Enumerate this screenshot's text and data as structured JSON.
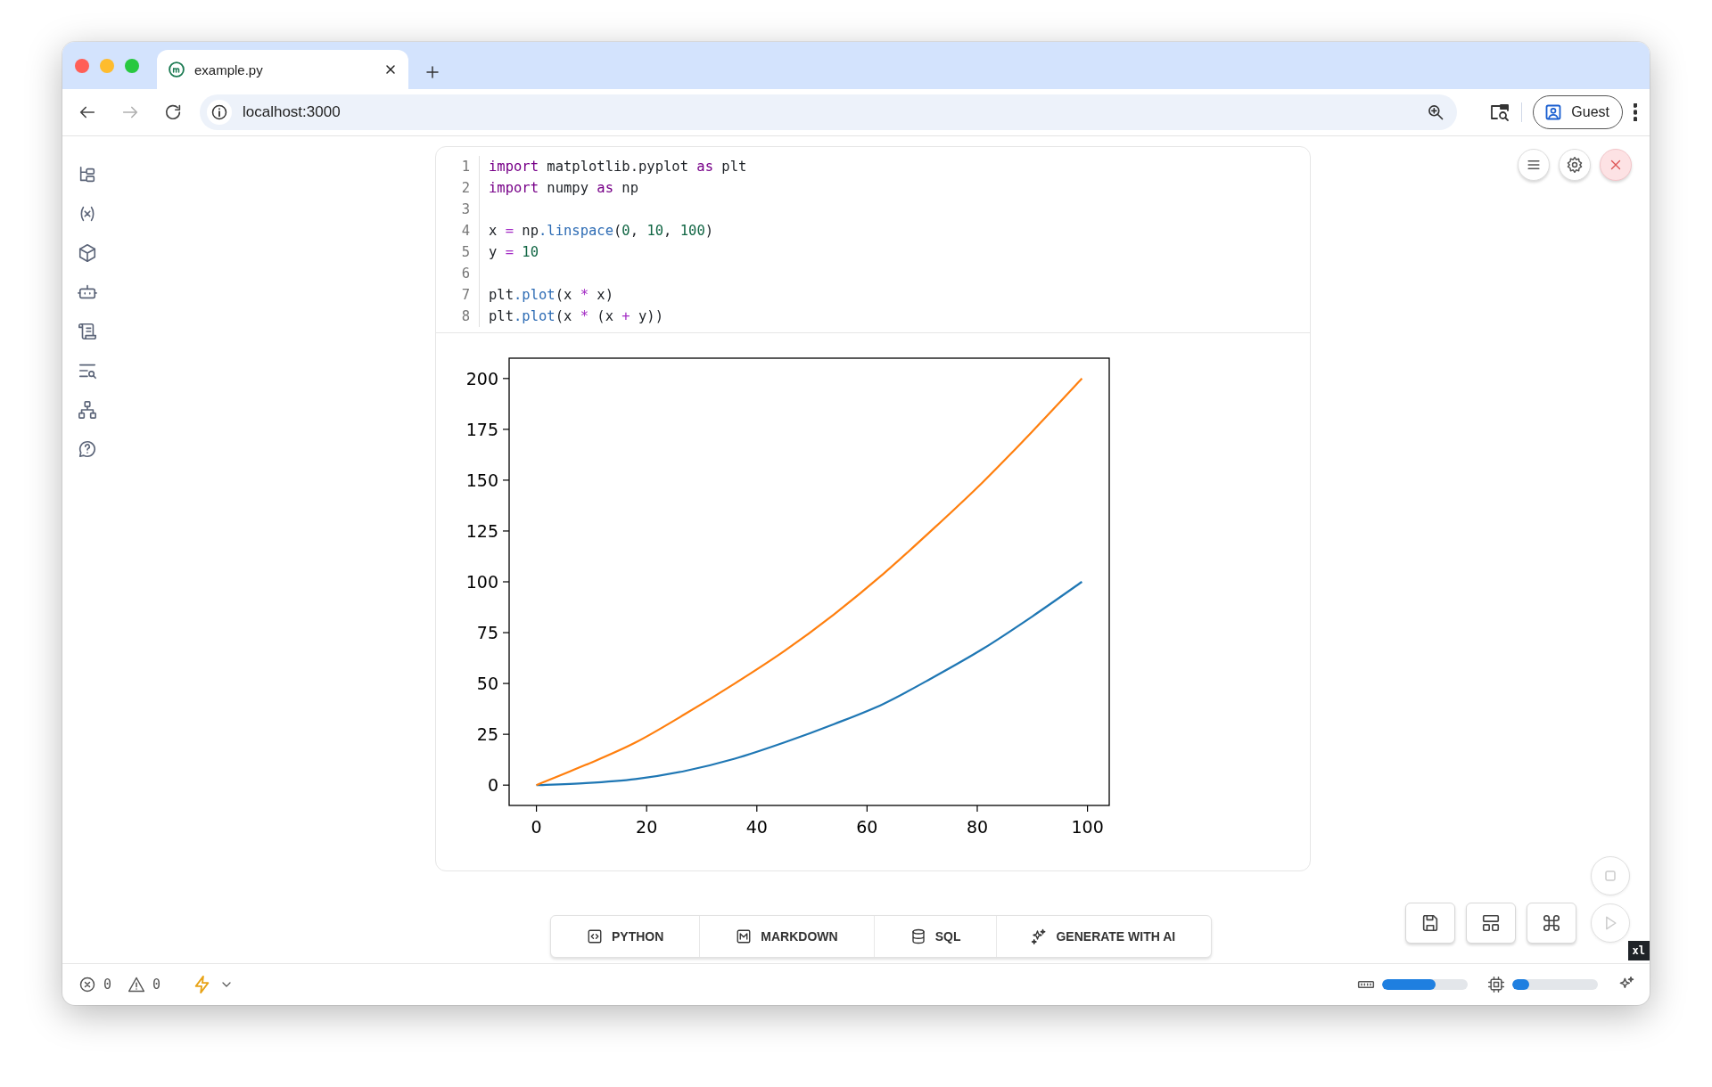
{
  "browser": {
    "tab": {
      "title": "example.py",
      "selected": true
    },
    "nav": [
      {
        "kind": "back",
        "disabled": false
      },
      {
        "kind": "forward",
        "disabled": true
      },
      {
        "kind": "reload",
        "disabled": false
      }
    ],
    "address": "localhost:3000",
    "profile": "Guest"
  },
  "sidebar": {
    "items": [
      {
        "kind": "tree"
      },
      {
        "kind": "variables"
      },
      {
        "kind": "package"
      },
      {
        "kind": "bot"
      },
      {
        "kind": "scroll"
      },
      {
        "kind": "search-list"
      },
      {
        "kind": "hierarchy"
      },
      {
        "kind": "help"
      }
    ]
  },
  "cell": {
    "lines": [
      {
        "number": "1",
        "tokens": [
          {
            "text": "import",
            "kind": "keyword"
          },
          {
            "text": " matplotlib.pyplot ",
            "kind": "plain"
          },
          {
            "text": "as",
            "kind": "keyword"
          },
          {
            "text": " plt",
            "kind": "plain"
          }
        ]
      },
      {
        "number": "2",
        "tokens": [
          {
            "text": "import",
            "kind": "keyword"
          },
          {
            "text": " numpy ",
            "kind": "plain"
          },
          {
            "text": "as",
            "kind": "keyword"
          },
          {
            "text": " np",
            "kind": "plain"
          }
        ]
      },
      {
        "number": "3"
      },
      {
        "number": "4",
        "tokens": [
          {
            "text": "x ",
            "kind": "plain"
          },
          {
            "text": "=",
            "kind": "operator"
          },
          {
            "text": " np",
            "kind": "plain"
          },
          {
            "text": ".linspace",
            "kind": "function"
          },
          {
            "text": "(",
            "kind": "plain"
          },
          {
            "text": "0",
            "kind": "number"
          },
          {
            "text": ", ",
            "kind": "plain"
          },
          {
            "text": "10",
            "kind": "number"
          },
          {
            "text": ", ",
            "kind": "plain"
          },
          {
            "text": "100",
            "kind": "number"
          },
          {
            "text": ")",
            "kind": "plain"
          }
        ]
      },
      {
        "number": "5",
        "tokens": [
          {
            "text": "y ",
            "kind": "plain"
          },
          {
            "text": "=",
            "kind": "operator"
          },
          {
            "text": " 10",
            "kind": "number"
          }
        ]
      },
      {
        "number": "6"
      },
      {
        "number": "7",
        "tokens": [
          {
            "text": "plt",
            "kind": "plain"
          },
          {
            "text": ".plot",
            "kind": "function"
          },
          {
            "text": "(x ",
            "kind": "plain"
          },
          {
            "text": "*",
            "kind": "operator"
          },
          {
            "text": " x)",
            "kind": "plain"
          }
        ]
      },
      {
        "number": "8",
        "tokens": [
          {
            "text": "plt",
            "kind": "plain"
          },
          {
            "text": ".plot",
            "kind": "function"
          },
          {
            "text": "(x ",
            "kind": "plain"
          },
          {
            "text": "*",
            "kind": "operator"
          },
          {
            "text": " (x ",
            "kind": "plain"
          },
          {
            "text": "+",
            "kind": "operator"
          },
          {
            "text": " y))",
            "kind": "plain"
          }
        ]
      }
    ],
    "output": {
      "chart_data": {
        "type": "line",
        "x": [
          0,
          9,
          18,
          27,
          36,
          45,
          54,
          63,
          72,
          81,
          90,
          99
        ],
        "series": [
          {
            "color": "#1f77b4",
            "values": [
              0,
              1,
              3,
              7,
              13,
              21,
              30,
              40,
              53,
              67,
              83,
              100
            ]
          },
          {
            "color": "#ff7f0e",
            "values": [
              0,
              10,
              21,
              35,
              50,
              66,
              84,
              104,
              126,
              149,
              174,
              200
            ]
          }
        ],
        "xlim": [
          -4.95,
          103.95
        ],
        "ylim": [
          -10,
          210
        ],
        "xticks": [
          0,
          20,
          40,
          60,
          80,
          100
        ],
        "yticks": [
          0,
          25,
          50,
          75,
          100,
          125,
          150,
          175,
          200
        ]
      }
    }
  },
  "add_cell": [
    {
      "kind": "python",
      "label": "PYTHON"
    },
    {
      "kind": "markdown",
      "label": "MARKDOWN"
    },
    {
      "kind": "sql",
      "label": "SQL"
    },
    {
      "kind": "ai",
      "label": "GENERATE WITH AI"
    }
  ],
  "breakpoint_badge": "xl",
  "status_bar": {
    "errors": "0",
    "warnings": "0",
    "memory": {
      "level": 0.62
    },
    "cpu": {
      "level": 0.2
    }
  }
}
